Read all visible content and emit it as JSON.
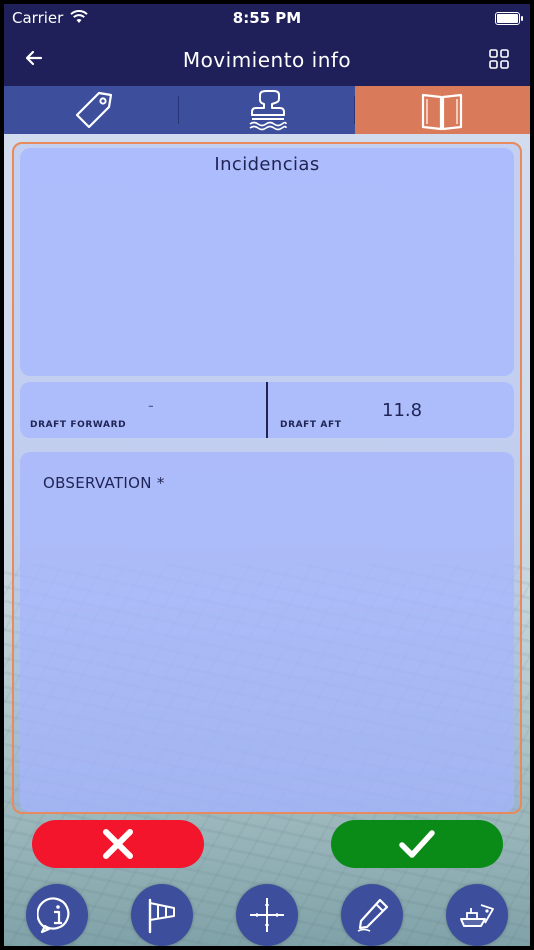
{
  "status": {
    "carrier": "Carrier",
    "time": "8:55 PM"
  },
  "nav": {
    "title": "Movimiento info"
  },
  "tabs": [
    {
      "icon": "tag-icon",
      "active": false
    },
    {
      "icon": "stamp-icon",
      "active": false
    },
    {
      "icon": "book-icon",
      "active": true
    }
  ],
  "incidents": {
    "label": "Incidencias"
  },
  "drafts": {
    "forward_label": "DRAFT FORWARD",
    "forward_value": "-",
    "aft_label": "DRAFT AFT",
    "aft_value": "11.8"
  },
  "observation": {
    "placeholder": "OBSERVATION *",
    "value": ""
  },
  "colors": {
    "navbar": "#1f1f5a",
    "tab": "#3d4f9c",
    "tab_active": "#d97a5a",
    "cancel": "#f3152b",
    "confirm": "#0a8a17",
    "panel_border": "#e88a5c"
  },
  "toolbar": [
    {
      "icon": "info-icon"
    },
    {
      "icon": "windsock-icon"
    },
    {
      "icon": "coordinates-icon"
    },
    {
      "icon": "pen-icon"
    },
    {
      "icon": "ship-icon"
    }
  ]
}
